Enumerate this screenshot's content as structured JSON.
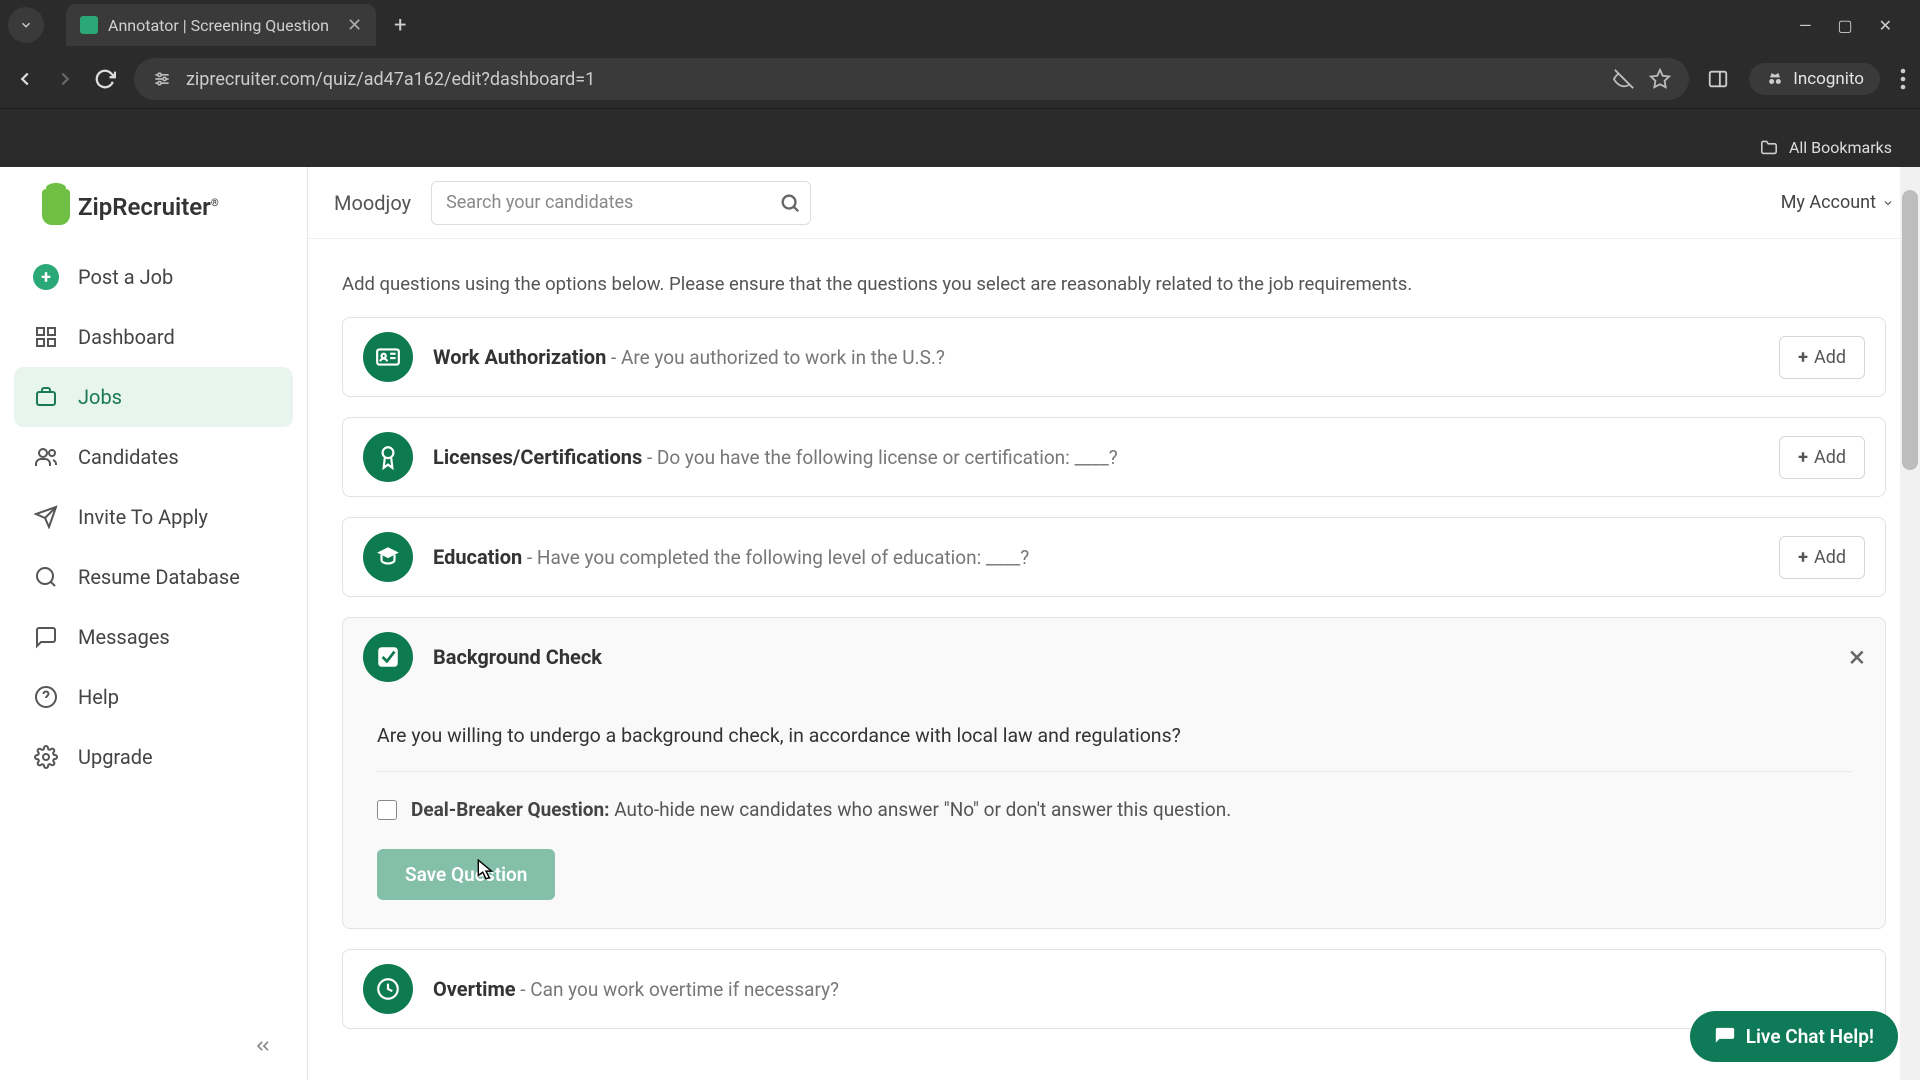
{
  "browser": {
    "tab_title": "Annotator | Screening Question",
    "url": "ziprecruiter.com/quiz/ad47a162/edit?dashboard=1",
    "incognito_label": "Incognito",
    "all_bookmarks": "All Bookmarks"
  },
  "logo": {
    "text": "ZipRecruiter"
  },
  "sidebar": {
    "items": [
      {
        "label": "Post a Job"
      },
      {
        "label": "Dashboard"
      },
      {
        "label": "Jobs"
      },
      {
        "label": "Candidates"
      },
      {
        "label": "Invite To Apply"
      },
      {
        "label": "Resume Database"
      },
      {
        "label": "Messages"
      },
      {
        "label": "Help"
      },
      {
        "label": "Upgrade"
      }
    ]
  },
  "topbar": {
    "account_name": "Moodjoy",
    "search_placeholder": "Search your candidates",
    "my_account": "My Account"
  },
  "instructions": "Add questions using the options below. Please ensure that the questions you select are reasonably related to the job requirements.",
  "questions": [
    {
      "title": "Work Authorization",
      "sub": " - Are you authorized to work in the U.S.?",
      "add": "Add"
    },
    {
      "title": "Licenses/Certifications",
      "sub": " - Do you have the following license or certification: ____?",
      "add": "Add"
    },
    {
      "title": "Education",
      "sub": " - Have you completed the following level of education: ____?",
      "add": "Add"
    }
  ],
  "expanded": {
    "title": "Background Check",
    "question": "Are you willing to undergo a background check, in accordance with local law and regulations?",
    "dealbreaker_label": "Deal-Breaker Question:",
    "dealbreaker_desc": " Auto-hide new candidates who answer \"No\" or don't answer this question.",
    "save": "Save Question"
  },
  "overtime": {
    "title": "Overtime",
    "sub": " - Can you work overtime if necessary?"
  },
  "chat": {
    "label": "Live Chat Help!"
  }
}
